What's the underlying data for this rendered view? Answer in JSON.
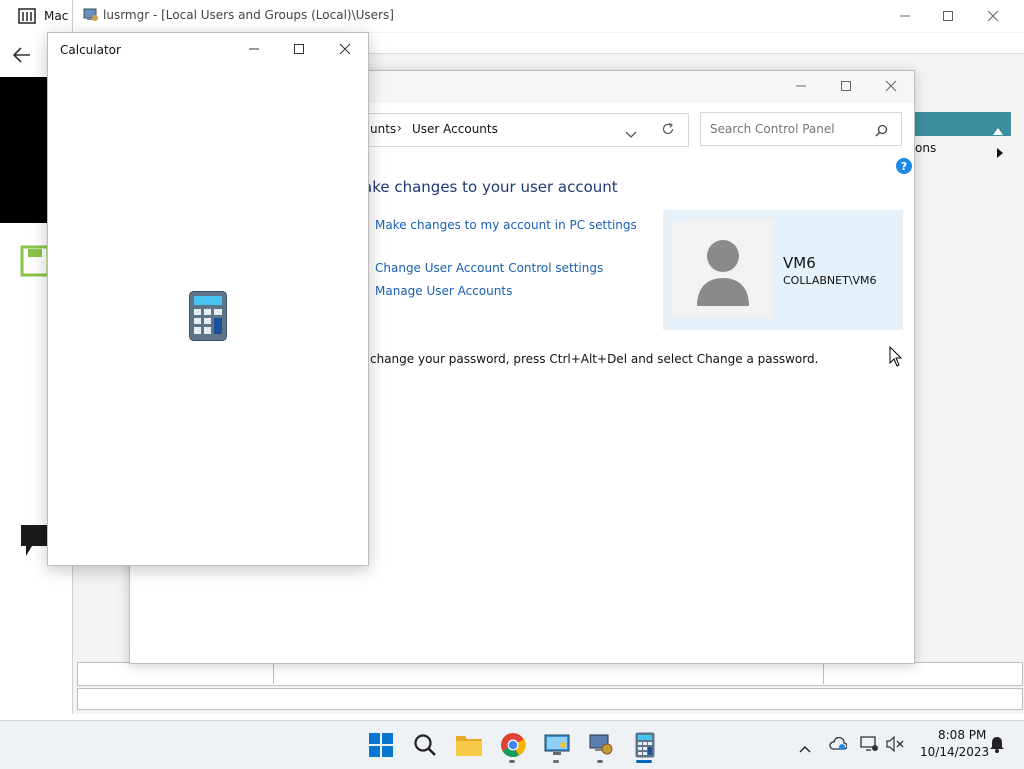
{
  "back_window": {
    "title_fragment": "Mac"
  },
  "lusrmgr": {
    "title": "lusrmgr - [Local Users and Groups (Local)\\Users]",
    "right_panel": {
      "item_label": "ons"
    }
  },
  "control_panel": {
    "breadcrumb": {
      "parent": "unts",
      "separator": "›",
      "current": "User Accounts"
    },
    "search": {
      "placeholder": "Search Control Panel"
    },
    "heading": "ake changes to your user account",
    "links": [
      "Make changes to my account in PC settings",
      "Change User Account Control settings",
      "Manage User Accounts"
    ],
    "user": {
      "name": "VM6",
      "domain": "COLLABNET\\VM6"
    },
    "password_hint": "change your password, press Ctrl+Alt+Del and select Change a password."
  },
  "calculator": {
    "title": "Calculator"
  },
  "taskbar": {
    "time": "8:08 PM",
    "date": "10/14/2023",
    "icons": [
      "windows-start-icon",
      "search-icon",
      "file-explorer-icon",
      "chrome-icon",
      "remote-desktop-icon",
      "computer-management-icon",
      "calculator-icon"
    ]
  },
  "colors": {
    "accent": "#0067c0",
    "link": "#1a5fb4",
    "user_tile": "#e5f1fb",
    "teal": "#3d8e9e"
  }
}
